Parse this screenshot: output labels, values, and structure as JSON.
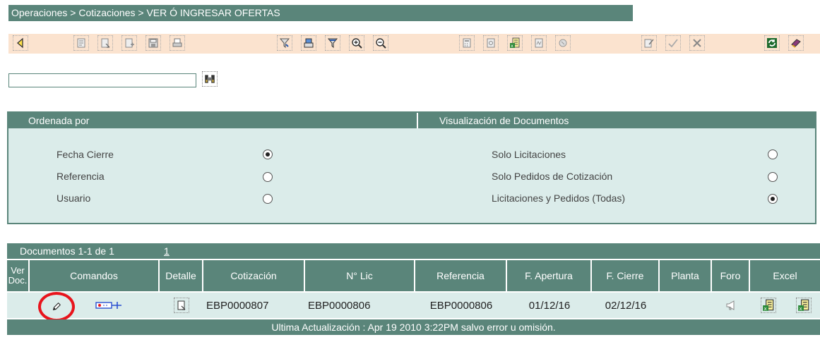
{
  "breadcrumb": "Operaciones > Cotizaciones > VER Ó INGRESAR OFERTAS",
  "toolbar": {
    "buttons": [
      "back-icon",
      "list-icon",
      "edit-doc-icon",
      "add-doc-icon",
      "save-icon",
      "print-icon",
      "filter-icon",
      "print-preview-icon",
      "filter-remove-icon",
      "zoom-in-icon",
      "zoom-out-icon",
      "calculator-icon",
      "attach-icon",
      "excel-icon",
      "pdf-icon",
      "delete-icon",
      "sign-icon",
      "approve-icon",
      "reject-icon",
      "refresh-icon",
      "help-book-icon"
    ]
  },
  "search": {
    "value": ""
  },
  "options": {
    "ordered_by_label": "Ordenada por",
    "visualization_label": "Visualización de Documentos",
    "order": [
      {
        "label": "Fecha Cierre",
        "selected": true
      },
      {
        "label": "Referencia",
        "selected": false
      },
      {
        "label": "Usuario",
        "selected": false
      }
    ],
    "visual": [
      {
        "label": "Solo Licitaciones",
        "selected": false
      },
      {
        "label": "Solo Pedidos de Cotización",
        "selected": false
      },
      {
        "label": "Licitaciones y Pedidos (Todas)",
        "selected": true
      }
    ]
  },
  "documents": {
    "count_label": "Documentos 1-1 de 1",
    "page_link": "1",
    "columns": [
      "Ver\nDoc.",
      "Comandos",
      "Detalle",
      "Cotización",
      "N° Lic",
      "Referencia",
      "F. Apertura",
      "F. Cierre",
      "Planta",
      "Foro",
      "Excel"
    ],
    "row": {
      "cotizacion": "EBP0000807",
      "n_lic": "EBP0000806",
      "referencia": "EBP0000806",
      "f_apertura": "01/12/16",
      "f_cierre": "02/12/16",
      "planta": ""
    },
    "footer": "Ultima Actualización : Apr 19 2010 3:22PM salvo error u omisión."
  },
  "colors": {
    "accent": "#5a857a",
    "toolbar_bg": "#fbe3cf",
    "panel_bg": "#dbecea",
    "highlight_circle": "#e8141c"
  }
}
